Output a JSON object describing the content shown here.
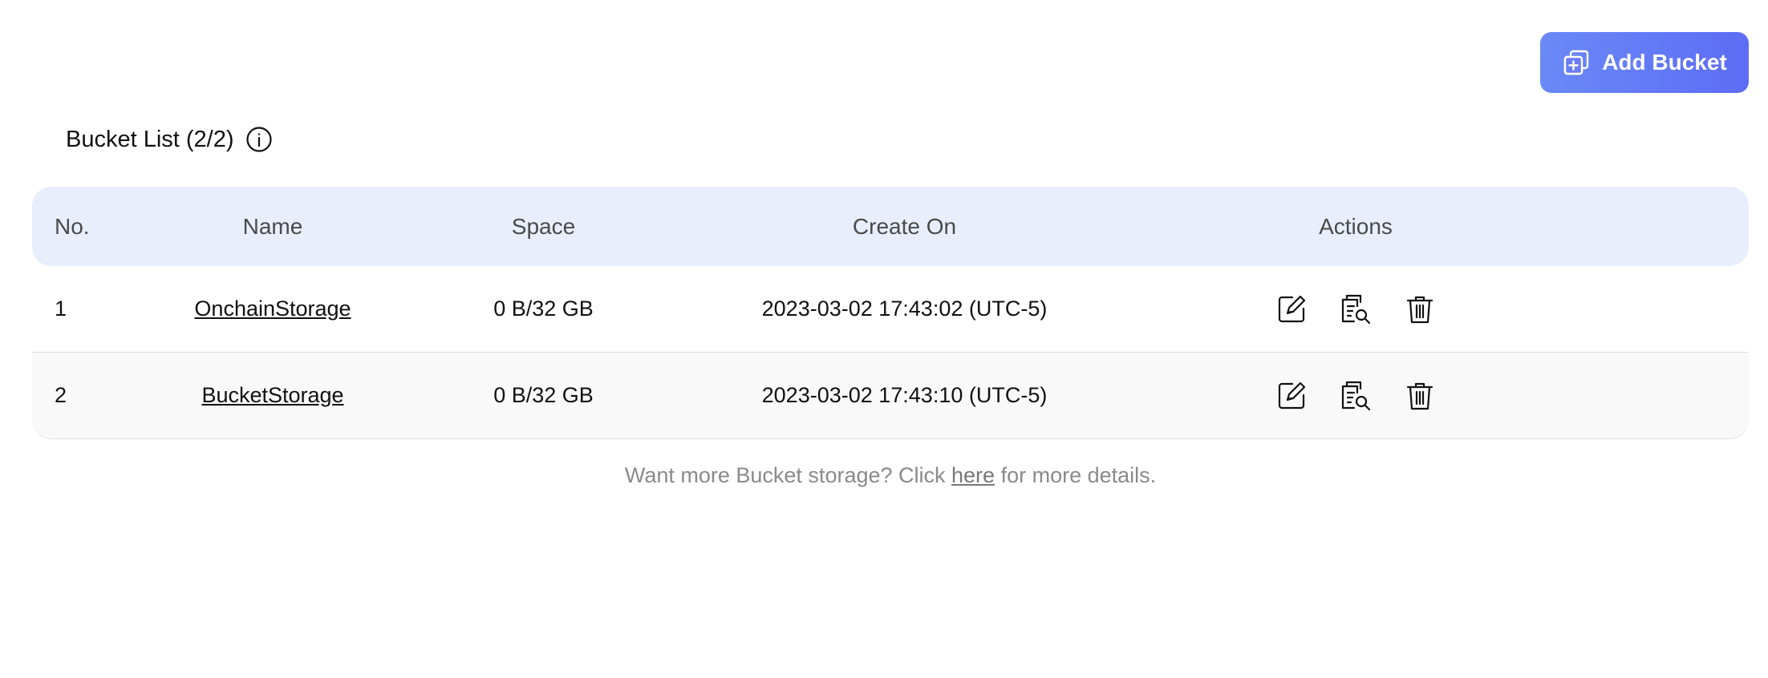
{
  "header": {
    "add_button_label": "Add Bucket",
    "list_title": "Bucket List (2/2)"
  },
  "table": {
    "columns": [
      "No.",
      "Name",
      "Space",
      "Create On",
      "Actions"
    ],
    "rows": [
      {
        "no": "1",
        "name": "OnchainStorage",
        "space": "0 B/32 GB",
        "created": "2023-03-02 17:43:02 (UTC-5)"
      },
      {
        "no": "2",
        "name": "BucketStorage",
        "space": "0 B/32 GB",
        "created": "2023-03-02 17:43:10 (UTC-5)"
      }
    ],
    "row_actions": [
      "edit-icon",
      "file-search-icon",
      "trash-icon"
    ]
  },
  "footer": {
    "text_before": "Want more Bucket storage? Click ",
    "link_text": "here",
    "text_after": " for more details."
  },
  "colors": {
    "accent": "#5d6cf5",
    "header_bg": "#e8eefc"
  }
}
